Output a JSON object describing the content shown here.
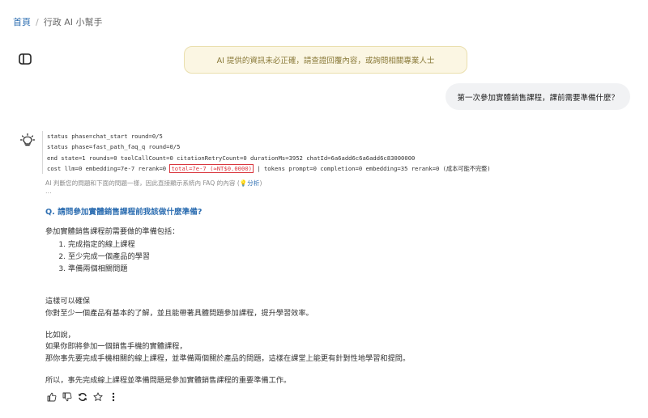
{
  "breadcrumb": {
    "home": "首頁",
    "separator": "/",
    "current": "行政 AI 小幫手"
  },
  "notice": {
    "text": "AI 提供的資訊未必正確，請查證回覆內容，或詢問相關專業人士"
  },
  "user_message": {
    "text": "第一次參加實體銷售課程，課前需要準備什麼？"
  },
  "log": {
    "line1": "status phase=chat_start round=0/5",
    "line2": "status phase=fast_path_faq_q round=0/5",
    "line3": "end state=1 rounds=0 toolCallCount=0 citationRetryCount=0 durationMs=3952 chatId=6a6add6c6a6add6c83000000",
    "line4_prefix": "cost llm=0 embedding=7e-7 rerank=0 ",
    "line4_highlight": "total=7e-7 (≈NT$0.0000)",
    "line4_suffix": " | tokens prompt=0 completion=0 embedding=35 rerank=0 (成本可能不完整)"
  },
  "ai_note": {
    "text": "AI 判斷您的問題和下面的問題一樣，因此直接顯示系統內 FAQ 的內容 (",
    "link": "💡分析",
    "close": ")"
  },
  "ellipsis": "...",
  "question": "Q. 請問參加實體銷售課程前我該做什麼準備?",
  "answer": {
    "intro": "參加實體銷售課程前需要做的準備包括：",
    "list": [
      "完成指定的線上課程",
      "至少完成一個產品的學習",
      "準備兩個相關問題"
    ],
    "p1a": "這樣可以確保",
    "p1b": "你對至少一個產品有基本的了解，並且能帶著具體問題參加課程，提升學習效率。",
    "p2a": "比如說，",
    "p2b": "如果你即將參加一個銷售手機的實體課程，",
    "p2c": "那你事先要完成手機相關的線上課程，並準備兩個關於產品的問題，這樣在課堂上能更有針對性地學習和提問。",
    "p3": "所以，事先完成線上課程並準備問題是參加實體銷售課程的重要準備工作。"
  }
}
